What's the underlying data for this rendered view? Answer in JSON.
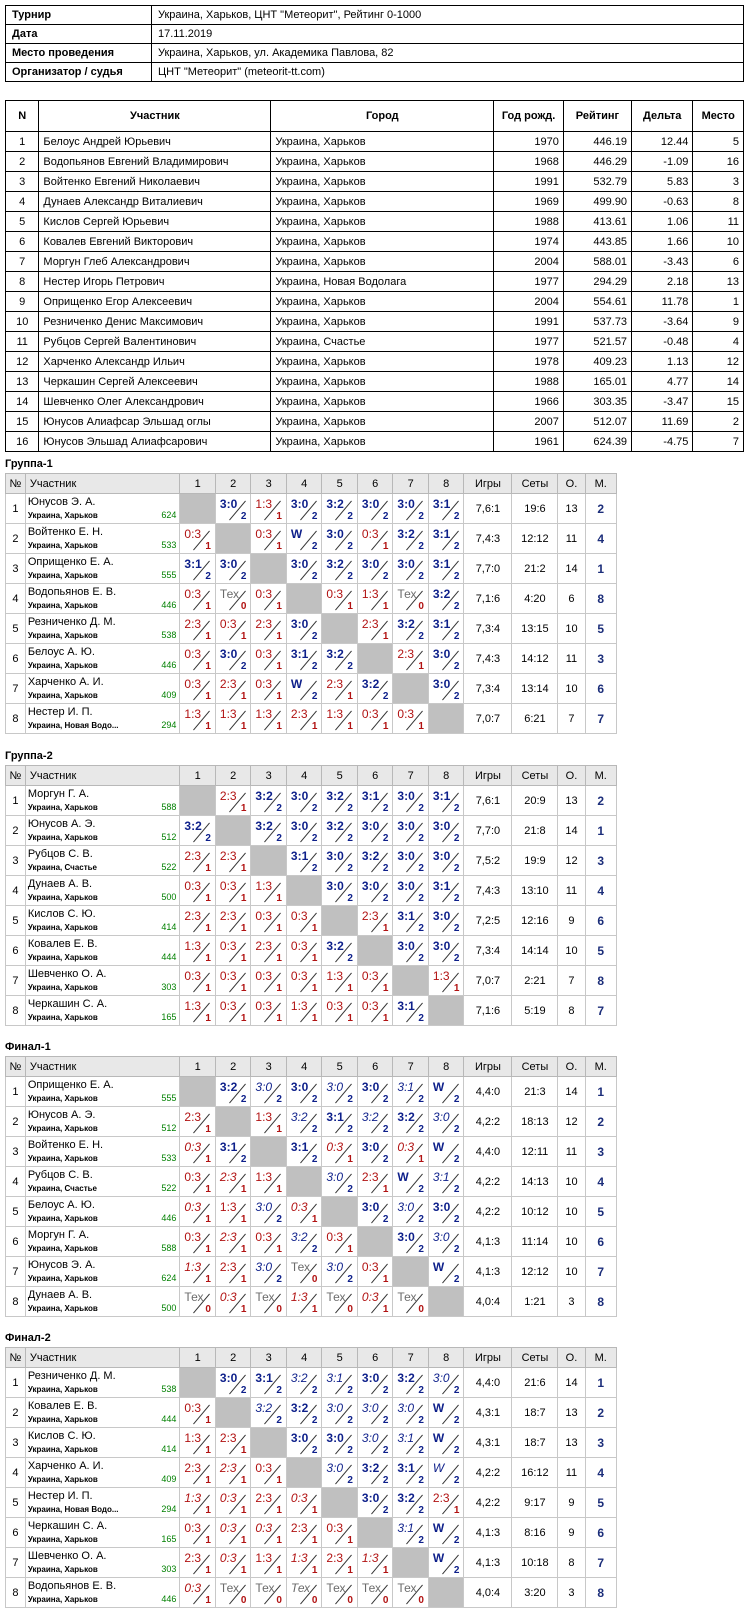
{
  "info": [
    {
      "k": "Турнир",
      "v": "Украина, Харьков, ЦНТ \"Метеорит\", Рейтинг 0-1000"
    },
    {
      "k": "Дата",
      "v": "17.11.2019"
    },
    {
      "k": "Место проведения",
      "v": "Украина, Харьков, ул. Академика Павлова, 82"
    },
    {
      "k": "Организатор / судья",
      "v": "ЦНТ \"Метеорит\" (meteorit-tt.com)"
    }
  ],
  "participants": {
    "headers": [
      "N",
      "Участник",
      "Город",
      "Год рожд.",
      "Рейтинг",
      "Дельта",
      "Место"
    ],
    "rows": [
      [
        "1",
        "Белоус Андрей Юрьевич",
        "Украина, Харьков",
        "1970",
        "446.19",
        "12.44",
        "5"
      ],
      [
        "2",
        "Водопьянов Евгений Владимирович",
        "Украина, Харьков",
        "1968",
        "446.29",
        "-1.09",
        "16"
      ],
      [
        "3",
        "Войтенко Евгений Николаевич",
        "Украина, Харьков",
        "1991",
        "532.79",
        "5.83",
        "3"
      ],
      [
        "4",
        "Дунаев Александр Виталиевич",
        "Украина, Харьков",
        "1969",
        "499.90",
        "-0.63",
        "8"
      ],
      [
        "5",
        "Кислов Сергей Юрьевич",
        "Украина, Харьков",
        "1988",
        "413.61",
        "1.06",
        "11"
      ],
      [
        "6",
        "Ковалев Евгений Викторович",
        "Украина, Харьков",
        "1974",
        "443.85",
        "1.66",
        "10"
      ],
      [
        "7",
        "Моргун Глеб Александрович",
        "Украина, Харьков",
        "2004",
        "588.01",
        "-3.43",
        "6"
      ],
      [
        "8",
        "Нестер Игорь Петрович",
        "Украина, Новая Водолага",
        "1977",
        "294.29",
        "2.18",
        "13"
      ],
      [
        "9",
        "Оприщенко Егор Алексеевич",
        "Украина, Харьков",
        "2004",
        "554.61",
        "11.78",
        "1"
      ],
      [
        "10",
        "Резниченко Денис Максимович",
        "Украина, Харьков",
        "1991",
        "537.73",
        "-3.64",
        "9"
      ],
      [
        "11",
        "Рубцов Сергей Валентинович",
        "Украина, Счастье",
        "1977",
        "521.57",
        "-0.48",
        "4"
      ],
      [
        "12",
        "Харченко Александр Ильич",
        "Украина, Харьков",
        "1978",
        "409.23",
        "1.13",
        "12"
      ],
      [
        "13",
        "Черкашин Сергей Алексеевич",
        "Украина, Харьков",
        "1988",
        "165.01",
        "4.77",
        "14"
      ],
      [
        "14",
        "Шевченко Олег Александрович",
        "Украина, Харьков",
        "1966",
        "303.35",
        "-3.47",
        "15"
      ],
      [
        "15",
        "Юнусов Алиафсар Эльшад оглы",
        "Украина, Харьков",
        "2007",
        "512.07",
        "11.69",
        "2"
      ],
      [
        "16",
        "Юнусов Эльшад Алиафсарович",
        "Украина, Харьков",
        "1961",
        "624.39",
        "-4.75",
        "7"
      ]
    ]
  },
  "group_headers": {
    "no": "№",
    "player": "Участник",
    "cols": [
      "1",
      "2",
      "3",
      "4",
      "5",
      "6",
      "7",
      "8"
    ],
    "games": "Игры",
    "sets": "Сеты",
    "pts": "О.",
    "place": "М."
  },
  "groups": [
    {
      "title": "Группа-1",
      "rows": [
        {
          "name": "Юнусов Э. А.",
          "city": "Украина, Харьков",
          "rating": "624",
          "cells": [
            "",
            "3:0|2",
            "1:3|1",
            "3:0|2",
            "3:2|2",
            "3:0|2",
            "3:0|2",
            "3:1|2"
          ],
          "games": "7,6:1",
          "sets": "19:6",
          "pts": "13",
          "place": "2"
        },
        {
          "name": "Войтенко Е. Н.",
          "city": "Украина, Харьков",
          "rating": "533",
          "cells": [
            "0:3|1",
            "",
            "0:3|1",
            "W|2",
            "3:0|2",
            "0:3|1",
            "3:2|2",
            "3:1|2"
          ],
          "games": "7,4:3",
          "sets": "12:12",
          "pts": "11",
          "place": "4"
        },
        {
          "name": "Оприщенко Е. А.",
          "city": "Украина, Харьков",
          "rating": "555",
          "cells": [
            "3:1|2",
            "3:0|2",
            "",
            "3:0|2",
            "3:2|2",
            "3:0|2",
            "3:0|2",
            "3:1|2"
          ],
          "games": "7,7:0",
          "sets": "21:2",
          "pts": "14",
          "place": "1"
        },
        {
          "name": "Водопьянов Е. В.",
          "city": "Украина, Харьков",
          "rating": "446",
          "cells": [
            "0:3|1",
            "Тех|0",
            "0:3|1",
            "",
            "0:3|1",
            "1:3|1",
            "Тех|0",
            "3:2|2"
          ],
          "games": "7,1:6",
          "sets": "4:20",
          "pts": "6",
          "place": "8"
        },
        {
          "name": "Резниченко Д. М.",
          "city": "Украина, Харьков",
          "rating": "538",
          "cells": [
            "2:3|1",
            "0:3|1",
            "2:3|1",
            "3:0|2",
            "",
            "2:3|1",
            "3:2|2",
            "3:1|2"
          ],
          "games": "7,3:4",
          "sets": "13:15",
          "pts": "10",
          "place": "5"
        },
        {
          "name": "Белоус А. Ю.",
          "city": "Украина, Харьков",
          "rating": "446",
          "cells": [
            "0:3|1",
            "3:0|2",
            "0:3|1",
            "3:1|2",
            "3:2|2",
            "",
            "2:3|1",
            "3:0|2"
          ],
          "games": "7,4:3",
          "sets": "14:12",
          "pts": "11",
          "place": "3"
        },
        {
          "name": "Харченко А. И.",
          "city": "Украина, Харьков",
          "rating": "409",
          "cells": [
            "0:3|1",
            "2:3|1",
            "0:3|1",
            "W|2",
            "2:3|1",
            "3:2|2",
            "",
            "3:0|2"
          ],
          "games": "7,3:4",
          "sets": "13:14",
          "pts": "10",
          "place": "6"
        },
        {
          "name": "Нестер И. П.",
          "city": "Украина, Новая Водо...",
          "rating": "294",
          "cells": [
            "1:3|1",
            "1:3|1",
            "1:3|1",
            "2:3|1",
            "1:3|1",
            "0:3|1",
            "0:3|1",
            ""
          ],
          "games": "7,0:7",
          "sets": "6:21",
          "pts": "7",
          "place": "7"
        }
      ]
    },
    {
      "title": "Группа-2",
      "rows": [
        {
          "name": "Моргун Г. А.",
          "city": "Украина, Харьков",
          "rating": "588",
          "cells": [
            "",
            "2:3|1",
            "3:2|2",
            "3:0|2",
            "3:2|2",
            "3:1|2",
            "3:0|2",
            "3:1|2"
          ],
          "games": "7,6:1",
          "sets": "20:9",
          "pts": "13",
          "place": "2"
        },
        {
          "name": "Юнусов А. Э.",
          "city": "Украина, Харьков",
          "rating": "512",
          "cells": [
            "3:2|2",
            "",
            "3:2|2",
            "3:0|2",
            "3:2|2",
            "3:0|2",
            "3:0|2",
            "3:0|2"
          ],
          "games": "7,7:0",
          "sets": "21:8",
          "pts": "14",
          "place": "1"
        },
        {
          "name": "Рубцов С. В.",
          "city": "Украина, Счастье",
          "rating": "522",
          "cells": [
            "2:3|1",
            "2:3|1",
            "",
            "3:1|2",
            "3:0|2",
            "3:2|2",
            "3:0|2",
            "3:0|2"
          ],
          "games": "7,5:2",
          "sets": "19:9",
          "pts": "12",
          "place": "3"
        },
        {
          "name": "Дунаев А. В.",
          "city": "Украина, Харьков",
          "rating": "500",
          "cells": [
            "0:3|1",
            "0:3|1",
            "1:3|1",
            "",
            "3:0|2",
            "3:0|2",
            "3:0|2",
            "3:1|2"
          ],
          "games": "7,4:3",
          "sets": "13:10",
          "pts": "11",
          "place": "4"
        },
        {
          "name": "Кислов С. Ю.",
          "city": "Украина, Харьков",
          "rating": "414",
          "cells": [
            "2:3|1",
            "2:3|1",
            "0:3|1",
            "0:3|1",
            "",
            "2:3|1",
            "3:1|2",
            "3:0|2"
          ],
          "games": "7,2:5",
          "sets": "12:16",
          "pts": "9",
          "place": "6"
        },
        {
          "name": "Ковалев Е. В.",
          "city": "Украина, Харьков",
          "rating": "444",
          "cells": [
            "1:3|1",
            "0:3|1",
            "2:3|1",
            "0:3|1",
            "3:2|2",
            "",
            "3:0|2",
            "3:0|2"
          ],
          "games": "7,3:4",
          "sets": "14:14",
          "pts": "10",
          "place": "5"
        },
        {
          "name": "Шевченко О. А.",
          "city": "Украина, Харьков",
          "rating": "303",
          "cells": [
            "0:3|1",
            "0:3|1",
            "0:3|1",
            "0:3|1",
            "1:3|1",
            "0:3|1",
            "",
            "1:3|1"
          ],
          "games": "7,0:7",
          "sets": "2:21",
          "pts": "7",
          "place": "8"
        },
        {
          "name": "Черкашин С. А.",
          "city": "Украина, Харьков",
          "rating": "165",
          "cells": [
            "1:3|1",
            "0:3|1",
            "0:3|1",
            "1:3|1",
            "0:3|1",
            "0:3|1",
            "3:1|2",
            ""
          ],
          "games": "7,1:6",
          "sets": "5:19",
          "pts": "8",
          "place": "7"
        }
      ]
    },
    {
      "title": "Финал-1",
      "rows": [
        {
          "name": "Оприщенко Е. А.",
          "city": "Украина, Харьков",
          "rating": "555",
          "cells": [
            "",
            "3:2|2",
            "i3:0|2",
            "3:0|2",
            "i3:0|2",
            "3:0|2",
            "i3:1|2",
            "W|2"
          ],
          "games": "4,4:0",
          "sets": "21:3",
          "pts": "14",
          "place": "1"
        },
        {
          "name": "Юнусов А. Э.",
          "city": "Украина, Харьков",
          "rating": "512",
          "cells": [
            "2:3|1",
            "",
            "1:3|1",
            "i3:2|2",
            "3:1|2",
            "i3:2|2",
            "3:2|2",
            "i3:0|2"
          ],
          "games": "4,2:2",
          "sets": "18:13",
          "pts": "12",
          "place": "2"
        },
        {
          "name": "Войтенко Е. Н.",
          "city": "Украина, Харьков",
          "rating": "533",
          "cells": [
            "i0:3|1",
            "3:1|2",
            "",
            "3:1|2",
            "i0:3|1",
            "3:0|2",
            "i0:3|1",
            "W|2"
          ],
          "games": "4,4:0",
          "sets": "12:11",
          "pts": "11",
          "place": "3"
        },
        {
          "name": "Рубцов С. В.",
          "city": "Украина, Счастье",
          "rating": "522",
          "cells": [
            "0:3|1",
            "i2:3|1",
            "1:3|1",
            "",
            "i3:0|2",
            "2:3|1",
            "W|2",
            "i3:1|2"
          ],
          "games": "4,2:2",
          "sets": "14:13",
          "pts": "10",
          "place": "4"
        },
        {
          "name": "Белоус А. Ю.",
          "city": "Украина, Харьков",
          "rating": "446",
          "cells": [
            "i0:3|1",
            "1:3|1",
            "i3:0|2",
            "i0:3|1",
            "",
            "3:0|2",
            "i3:0|2",
            "3:0|2"
          ],
          "games": "4,2:2",
          "sets": "10:12",
          "pts": "10",
          "place": "5"
        },
        {
          "name": "Моргун Г. А.",
          "city": "Украина, Харьков",
          "rating": "588",
          "cells": [
            "0:3|1",
            "i2:3|1",
            "0:3|1",
            "i3:2|2",
            "0:3|1",
            "",
            "3:0|2",
            "i3:0|2"
          ],
          "games": "4,1:3",
          "sets": "11:14",
          "pts": "10",
          "place": "6"
        },
        {
          "name": "Юнусов Э. А.",
          "city": "Украина, Харьков",
          "rating": "624",
          "cells": [
            "i1:3|1",
            "2:3|1",
            "i3:0|2",
            "Тех|0",
            "i3:0|2",
            "0:3|1",
            "",
            "W|2"
          ],
          "games": "4,1:3",
          "sets": "12:12",
          "pts": "10",
          "place": "7"
        },
        {
          "name": "Дунаев А. В.",
          "city": "Украина, Харьков",
          "rating": "500",
          "cells": [
            "Тех|0",
            "i0:3|1",
            "Тех|0",
            "i1:3|1",
            "Тех|0",
            "i0:3|1",
            "Тех|0",
            ""
          ],
          "games": "4,0:4",
          "sets": "1:21",
          "pts": "3",
          "place": "8"
        }
      ]
    },
    {
      "title": "Финал-2",
      "rows": [
        {
          "name": "Резниченко Д. М.",
          "city": "Украина, Харьков",
          "rating": "538",
          "cells": [
            "",
            "3:0|2",
            "3:1|2",
            "i3:2|2",
            "i3:1|2",
            "3:0|2",
            "3:2|2",
            "i3:0|2"
          ],
          "games": "4,4:0",
          "sets": "21:6",
          "pts": "14",
          "place": "1"
        },
        {
          "name": "Ковалев Е. В.",
          "city": "Украина, Харьков",
          "rating": "444",
          "cells": [
            "0:3|1",
            "",
            "i3:2|2",
            "3:2|2",
            "i3:0|2",
            "i3:0|2",
            "i3:0|2",
            "W|2"
          ],
          "games": "4,3:1",
          "sets": "18:7",
          "pts": "13",
          "place": "2"
        },
        {
          "name": "Кислов С. Ю.",
          "city": "Украина, Харьков",
          "rating": "414",
          "cells": [
            "1:3|1",
            "2:3|1",
            "",
            "3:0|2",
            "3:0|2",
            "i3:0|2",
            "i3:1|2",
            "W|2"
          ],
          "games": "4,3:1",
          "sets": "18:7",
          "pts": "13",
          "place": "3"
        },
        {
          "name": "Харченко А. И.",
          "city": "Украина, Харьков",
          "rating": "409",
          "cells": [
            "2:3|1",
            "i2:3|1",
            "0:3|1",
            "",
            "i3:0|2",
            "3:2|2",
            "3:1|2",
            "iW|2"
          ],
          "games": "4,2:2",
          "sets": "16:12",
          "pts": "11",
          "place": "4"
        },
        {
          "name": "Нестер И. П.",
          "city": "Украина, Новая Водо...",
          "rating": "294",
          "cells": [
            "i1:3|1",
            "i0:3|1",
            "2:3|1",
            "i0:3|1",
            "",
            "3:0|2",
            "3:2|2",
            "2:3|1"
          ],
          "games": "4,2:2",
          "sets": "9:17",
          "pts": "9",
          "place": "5"
        },
        {
          "name": "Черкашин С. А.",
          "city": "Украина, Харьков",
          "rating": "165",
          "cells": [
            "0:3|1",
            "i0:3|1",
            "i0:3|1",
            "2:3|1",
            "0:3|1",
            "",
            "i3:1|2",
            "W|2"
          ],
          "games": "4,1:3",
          "sets": "8:16",
          "pts": "9",
          "place": "6"
        },
        {
          "name": "Шевченко О. А.",
          "city": "Украина, Харьков",
          "rating": "303",
          "cells": [
            "2:3|1",
            "i0:3|1",
            "1:3|1",
            "i1:3|1",
            "2:3|1",
            "i1:3|1",
            "",
            "W|2"
          ],
          "games": "4,1:3",
          "sets": "10:18",
          "pts": "8",
          "place": "7"
        },
        {
          "name": "Водопьянов Е. В.",
          "city": "Украина, Харьков",
          "rating": "446",
          "cells": [
            "i0:3|1",
            "Тех|0",
            "Тех|0",
            "iТех|0",
            "Тех|0",
            "Тех|0",
            "Тех|0",
            ""
          ],
          "games": "4,0:4",
          "sets": "3:20",
          "pts": "3",
          "place": "8"
        }
      ]
    }
  ]
}
